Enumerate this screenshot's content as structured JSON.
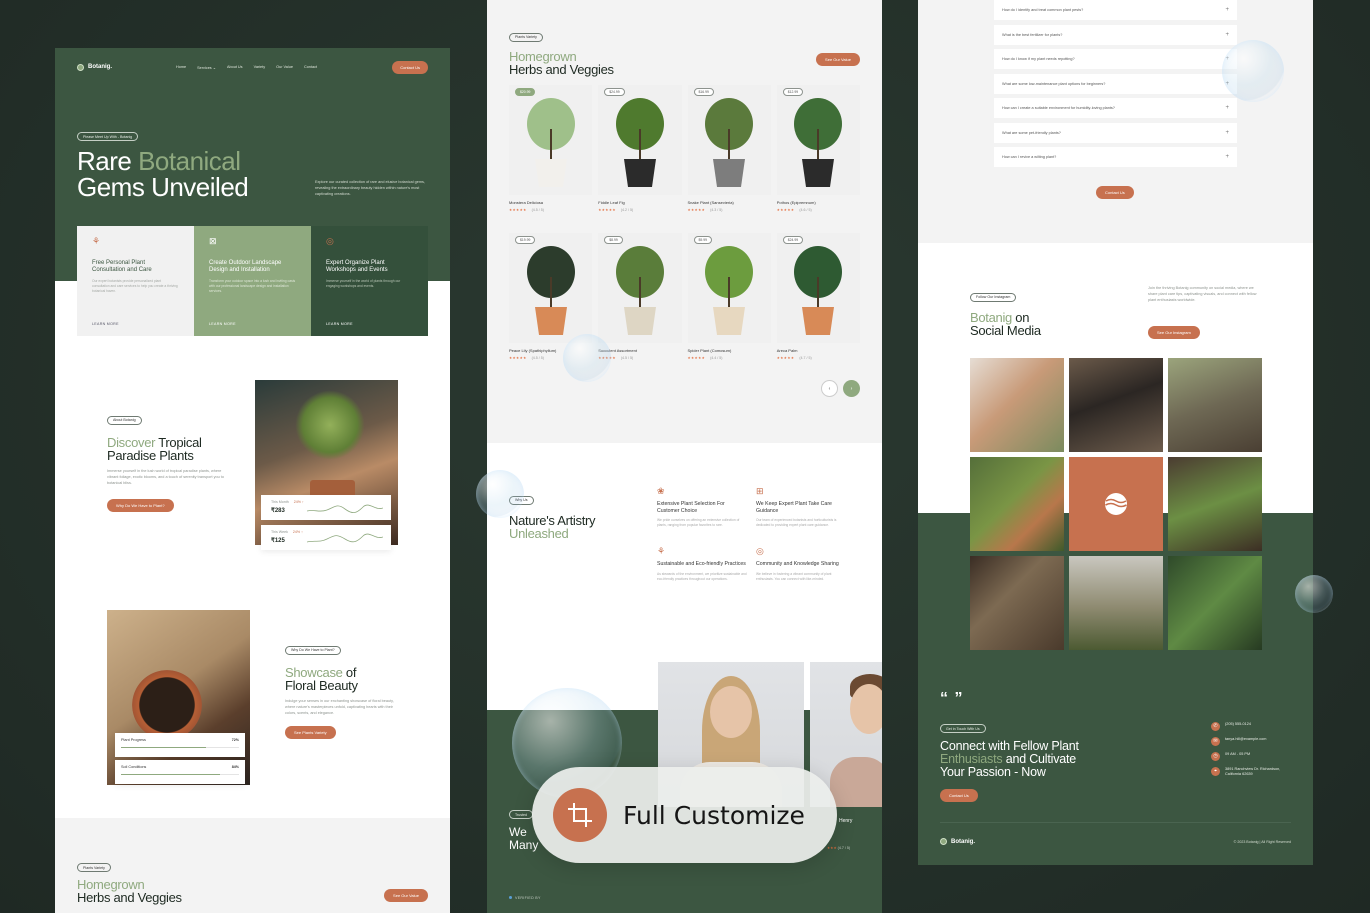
{
  "panel1": {
    "brand": "Botanig.",
    "nav": [
      "Home",
      "Services",
      "About Us",
      "Variety",
      "Our Value",
      "Contact"
    ],
    "nav_cta": "Contact Us",
    "hero": {
      "pill": "Please Meet Up With - Botanig",
      "title_line1_plain": "Rare ",
      "title_line1_accent": "Botanical",
      "title_line2": "Gems Unveiled",
      "description": "Explore our curated collection of rare and elusive botanical gems, revealing the extraordinary beauty hidden within nature's most captivating creations."
    },
    "service_cards": [
      {
        "icon": "tree-icon",
        "title": "Free Personal Plant Consultation and Care",
        "text": "Our expert botanists provide personalized plant consultation and care services to help you create a thriving botanical haven.",
        "link": "LEARN MORE"
      },
      {
        "icon": "landscape-icon",
        "title": "Create Outdoor Landscape Design and Installation",
        "text": "Transform your outdoor space into a lush and inviting oasis with our professional landscape design and installation services.",
        "link": "LEARN MORE"
      },
      {
        "icon": "leaf-badge-icon",
        "title": "Expert Organize Plant Workshops and Events",
        "text": "Immerse yourself in the world of plants through our engaging workshops and events.",
        "link": "LEARN MORE"
      }
    ],
    "about": {
      "pill": "About Botanig",
      "title_accent": "Discover",
      "title_rest1": " Tropical",
      "title_line2": "Paradise Plants",
      "text": "Immerse yourself in the lush world of tropical paradise plants, where vibrant foliage, exotic blooms, and a touch of serenity transport you to botanical bliss.",
      "button": "Why Do We Have to Plant?",
      "stats": [
        {
          "label": "This Month",
          "delta": "24% ↑",
          "value": "₹283"
        },
        {
          "label": "This Week",
          "delta": "24% ↑",
          "value": "₹125"
        }
      ]
    },
    "showcase": {
      "pill": "Why Do We Have to Plant?",
      "title_accent": "Showcase",
      "title_rest1": " of",
      "title_line2": "Floral Beauty",
      "text": "Indulge your senses in our enchanting showcase of floral beauty, where nature's masterpieces unfold, captivating hearts with their colors, scents, and elegance.",
      "button": "See Plants Variety",
      "progress": [
        {
          "label": "Plant Progress",
          "value_text": "72%",
          "value": 0.72
        },
        {
          "label": "Soil Conditions",
          "value_text": "84%",
          "value": 0.84
        }
      ]
    },
    "variety_preview": {
      "pill": "Plants Variety",
      "title_accent": "Homegrown",
      "title_line2": "Herbs and Veggies",
      "button": "See Our Value"
    }
  },
  "panel2": {
    "pill": "Plants Variety",
    "title_accent": "Homegrown",
    "title_line2": "Herbs and Veggies",
    "button": "See Our Value",
    "products": [
      {
        "name": "Monstera Deliciosa",
        "price": "$20.99",
        "rating": "(4.5 / 5)",
        "stars": "★★★★★",
        "highlight": true,
        "pot": "#f2f0ec",
        "leaf": "#9fc08a"
      },
      {
        "name": "Fiddle Leaf Fig",
        "price": "$24.99",
        "rating": "(4.2 / 5)",
        "stars": "★★★★★",
        "highlight": false,
        "pot": "#2b2b2b",
        "leaf": "#4f7a2e"
      },
      {
        "name": "Snake Plant (Sansevieria)",
        "price": "$16.99",
        "rating": "(4.3 / 5)",
        "stars": "★★★★★",
        "highlight": false,
        "pot": "#7d7d7d",
        "leaf": "#5b7a3c"
      },
      {
        "name": "Pothos (Epipremnum)",
        "price": "$12.99",
        "rating": "(4.6 / 5)",
        "stars": "★★★★★",
        "highlight": false,
        "pot": "#2b2b2b",
        "leaf": "#3f6e37"
      },
      {
        "name": "Peace Lily (Spathiphyllum)",
        "price": "$19.99",
        "rating": "(4.5 / 5)",
        "stars": "★★★★★",
        "highlight": false,
        "pot": "#d88a57",
        "leaf": "#2c3c2c"
      },
      {
        "name": "Succulent Assortment",
        "price": "$8.99",
        "rating": "(4.5 / 5)",
        "stars": "★★★★★",
        "highlight": false,
        "pot": "#ded6c4",
        "leaf": "#5a7d3a"
      },
      {
        "name": "Spider Plant (Comosum)",
        "price": "$9.99",
        "rating": "(4.4 / 5)",
        "stars": "★★★★★",
        "highlight": false,
        "pot": "#e7d8c0",
        "leaf": "#6c9c3e"
      },
      {
        "name": "Areca Palm",
        "price": "$24.99",
        "rating": "(4.7 / 5)",
        "stars": "★★★★★",
        "highlight": false,
        "pot": "#d88a57",
        "leaf": "#2e5a32"
      }
    ],
    "pager": {
      "prev": "‹",
      "next": "›"
    },
    "nature": {
      "pill": "Why Us",
      "title_line1": "Nature's Artistry",
      "title_accent": "Unleashed"
    },
    "features": [
      {
        "icon": "plant-select-icon",
        "title": "Extensive Plant Selection For Customer Choice",
        "text": "We pride ourselves on offering an extensive collection of plants, ranging from popular favorites to rare."
      },
      {
        "icon": "guidance-icon",
        "title": "We Keep Expert Plant Take Care Guidance",
        "text": "Our team of experienced botanists and horticulturists is dedicated to providing expert plant care guidance."
      },
      {
        "icon": "tree-icon",
        "title": "Sustainable and Eco-friendly Practices",
        "text": "As stewards of the environment, we prioritize sustainable and eco-friendly practices throughout our operations."
      },
      {
        "icon": "community-icon",
        "title": "Community and Knowledge Sharing",
        "text": "We believe in fostering a vibrant community of plant enthusiasts. You can connect with like-minded."
      }
    ],
    "testimonials": {
      "pill": "Trusted",
      "title_line1": "We",
      "title_line2": "Many",
      "reviewer": "Henry",
      "reviewer_rating": "(4.7 / 5)",
      "stars": "★★★",
      "verified": "VERIFIED BY"
    }
  },
  "overlay": {
    "icon": "crop-icon",
    "label": "Full Customize"
  },
  "panel3": {
    "faq": [
      "How do I identify and treat common plant pests?",
      "What is the best fertilizer for plants?",
      "How do I know if my plant needs repotting?",
      "What are some low-maintenance plant options for beginners?",
      "How can I create a suitable environment for humidity-loving plants?",
      "What are some pet-friendly plants?",
      "How can I revive a wilting plant?"
    ],
    "faq_button": "Contact Us",
    "social": {
      "pill": "Follow Our Instagram",
      "title_accent": "Botanig",
      "title_rest1": " on",
      "title_line2": "Social Media",
      "text": "Join the thriving Botanig community on social media, where we share plant care tips, captivating visuals, and connect with fellow plant enthusiasts worldwide.",
      "button": "See Our Instagram"
    },
    "cta": {
      "quote_mark": "“ ”",
      "pill": "Get in Touch With Us",
      "title_line1": "Connect with Fellow Plant",
      "title_accent": "Enthusiasts",
      "title_rest2": " and Cultivate",
      "title_line3": "Your Passion - Now",
      "button": "Contact Us"
    },
    "contacts": [
      {
        "icon": "phone-icon",
        "glyph": "✆",
        "text": "(205) 555-0124"
      },
      {
        "icon": "mail-icon",
        "glyph": "✉",
        "text": "tanya.hill@example.com"
      },
      {
        "icon": "clock-icon",
        "glyph": "◷",
        "text": "09 AM - 05 PM"
      },
      {
        "icon": "location-icon",
        "glyph": "⌖",
        "text": "3891 Ranchview Dr. Richardson, California 62639"
      }
    ],
    "footer_brand": "Botanig.",
    "copyright": "© 2023 Botanig | All Right Reserved"
  }
}
